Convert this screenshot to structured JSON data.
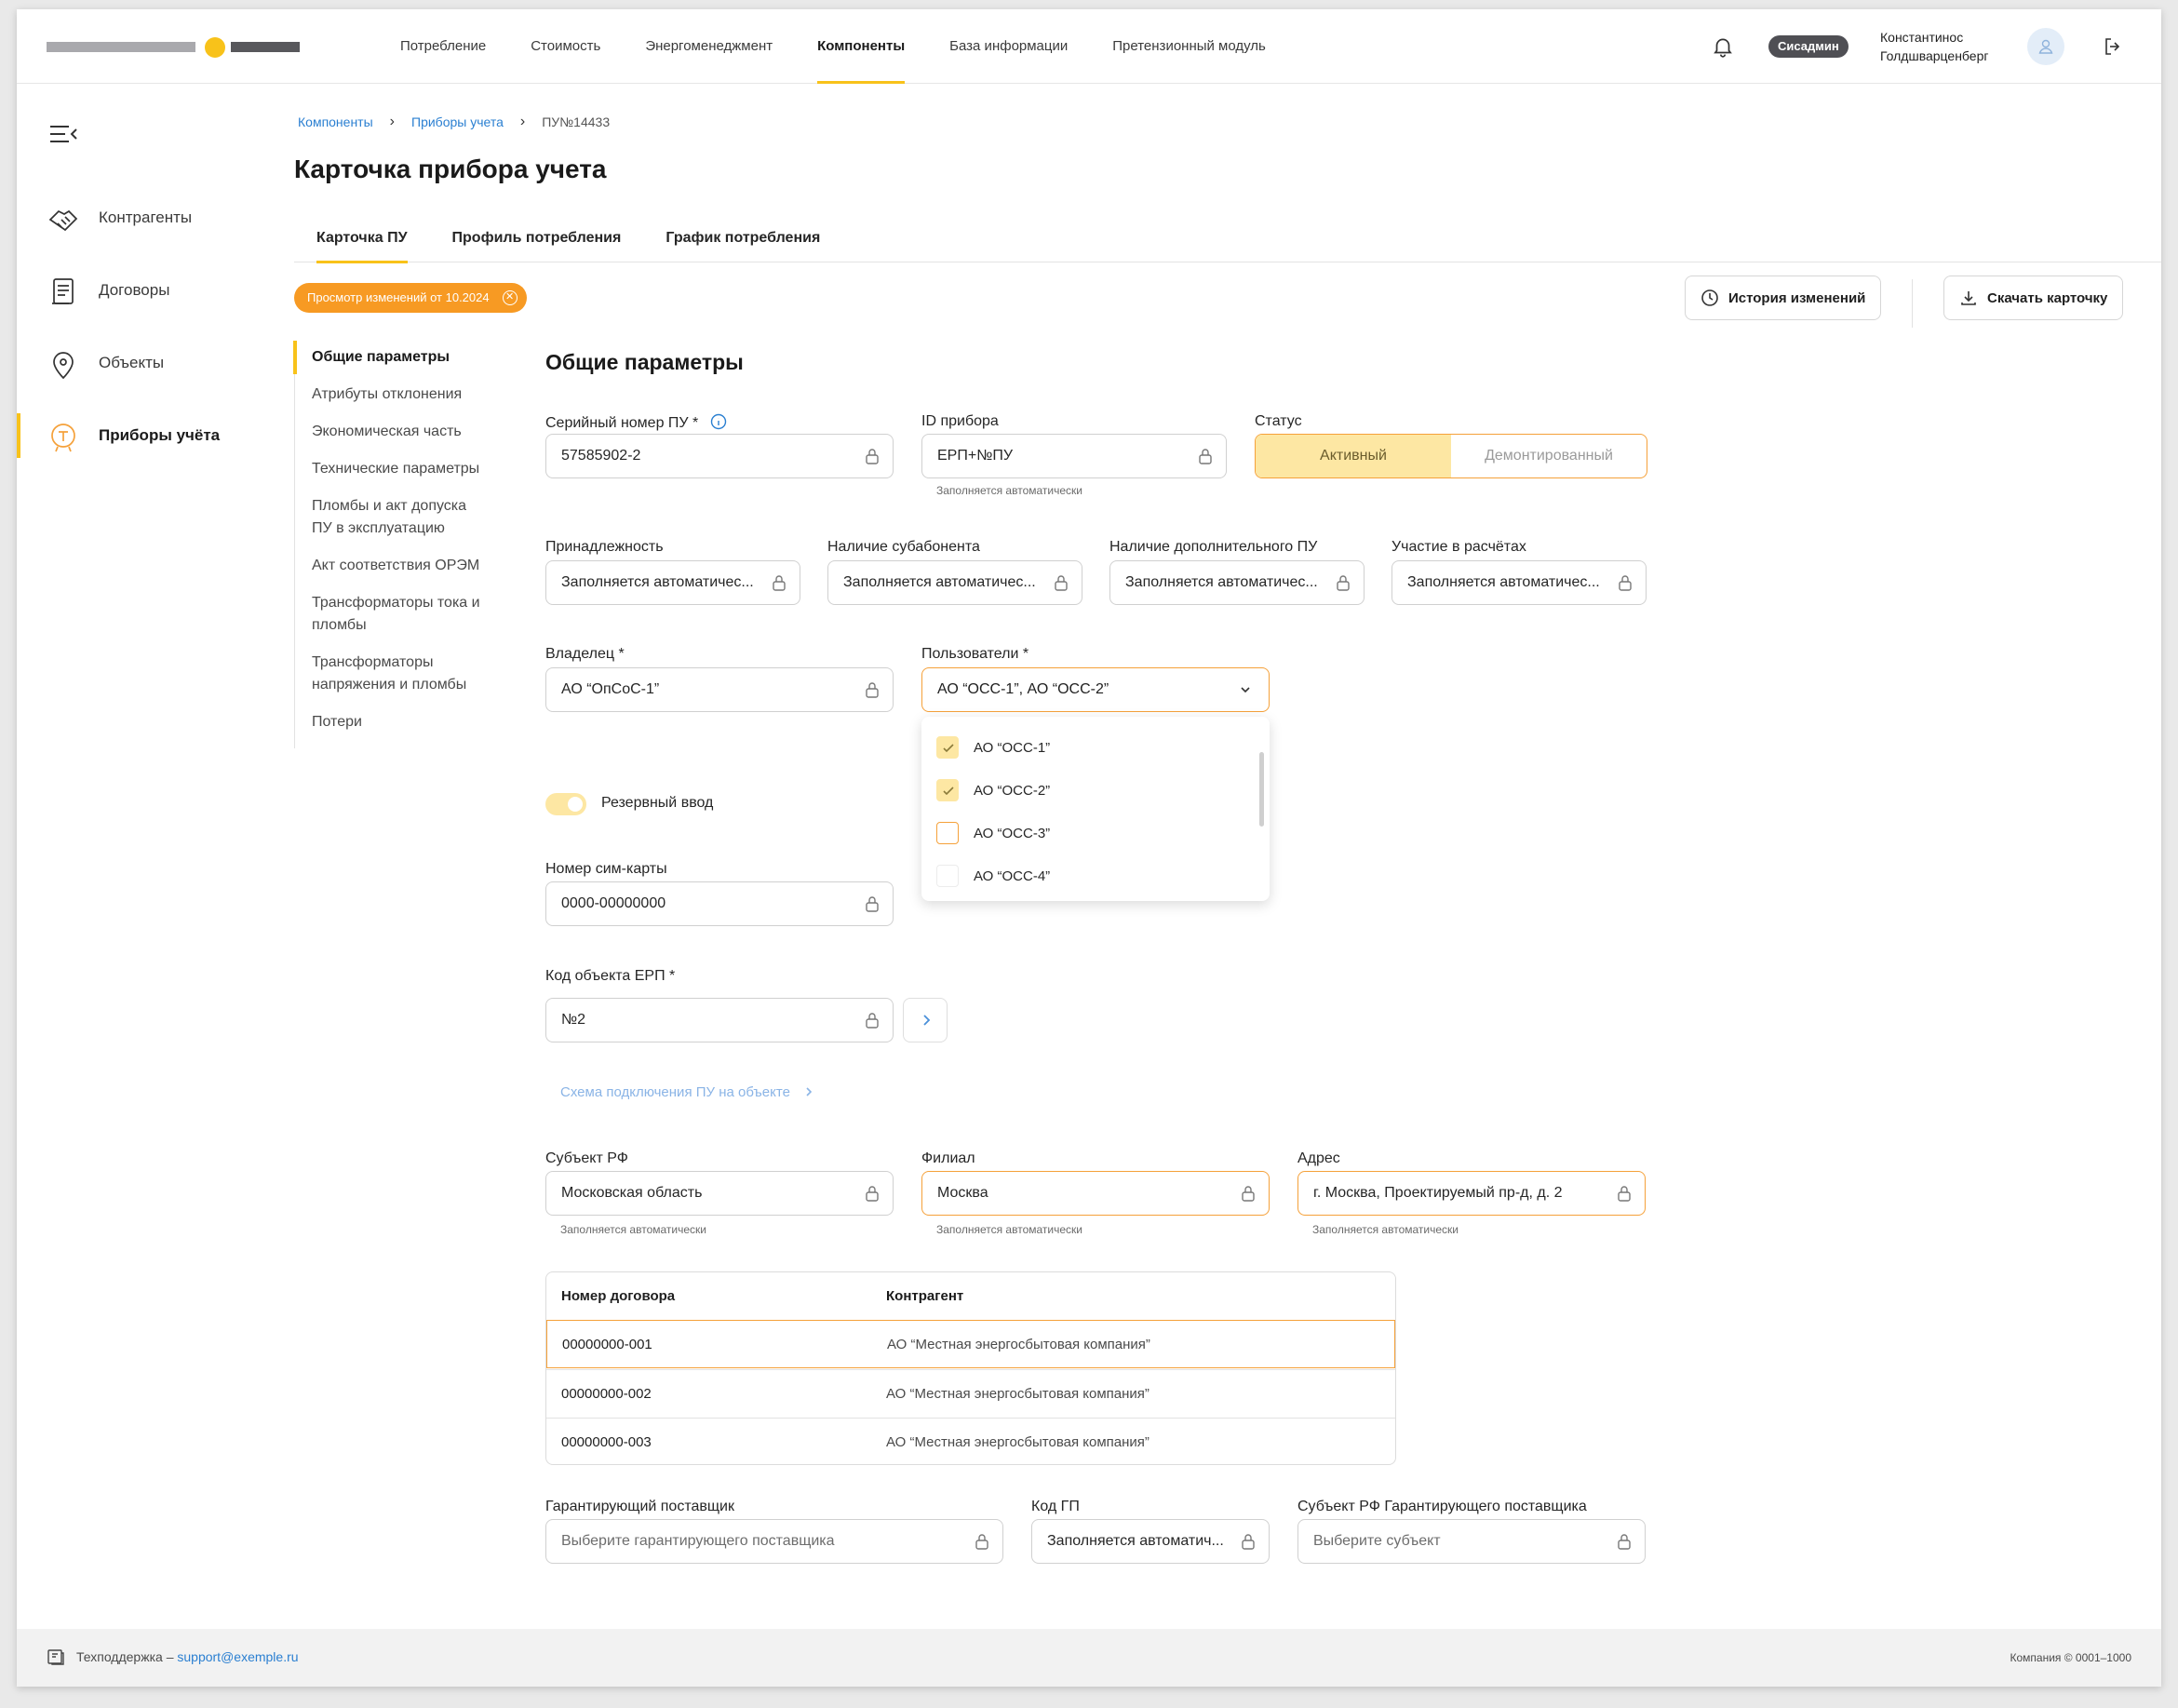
{
  "topnav": {
    "items": [
      "Потребление",
      "Стоимость",
      "Энергоменеджмент",
      "Компоненты",
      "База информации",
      "Претензионный модуль"
    ],
    "active_index": 3
  },
  "user": {
    "role": "Сисадмин",
    "name_line1": "Константинос",
    "name_line2": "Голдшварценберг"
  },
  "sidebar": {
    "items": [
      {
        "label": "Контрагенты",
        "icon": "handshake-icon"
      },
      {
        "label": "Договоры",
        "icon": "document-icon"
      },
      {
        "label": "Объекты",
        "icon": "location-pin-icon"
      },
      {
        "label": "Приборы учёта",
        "icon": "meter-icon"
      }
    ],
    "active_index": 3
  },
  "breadcrumb": [
    "Компоненты",
    "Приборы учета",
    "ПУ№14433"
  ],
  "page_title": "Карточка прибора учета",
  "tabs": [
    "Карточка ПУ",
    "Профиль потребления",
    "График потребления"
  ],
  "view_badge": "Просмотр изменений от 10.2024",
  "buttons": {
    "history": "История изменений",
    "download": "Скачать карточку"
  },
  "secnav": [
    "Общие параметры",
    "Атрибуты отклонения",
    "Экономическая часть",
    "Технические параметры",
    "Пломбы и акт допуска ПУ в эксплуатацию",
    "Акт соответствия ОРЭМ",
    "Трансформаторы тока и пломбы",
    "Трансформаторы напряжения и пломбы",
    "Потери"
  ],
  "section_title": "Общие параметры",
  "auto_hint": "Заполняется автоматически",
  "fields": {
    "serial": {
      "label": "Серийный номер ПУ *",
      "value": "57585902-2"
    },
    "device_id": {
      "label": "ID прибора",
      "value": "ЕРП+№ПУ"
    },
    "status": {
      "label": "Статус",
      "options": [
        "Активный",
        "Демонтированный"
      ],
      "selected": "Активный"
    },
    "belonging": {
      "label": "Принадлежность",
      "value": "Заполняется автоматичес..."
    },
    "subscriber": {
      "label": "Наличие субабонента",
      "value": "Заполняется автоматичес..."
    },
    "extra_pu": {
      "label": "Наличие дополнительного ПУ",
      "value": "Заполняется автоматичес..."
    },
    "calc": {
      "label": "Участие в расчётах",
      "value": "Заполняется автоматичес..."
    },
    "owner": {
      "label": "Владелец *",
      "value": "АО “ОпСоС-1”"
    },
    "users": {
      "label": "Пользователи *",
      "value": "АО “ОСС-1”, АО “ОСС-2”",
      "options": [
        {
          "label": "АО “ОСС-1”",
          "checked": true
        },
        {
          "label": "АО “ОСС-2”",
          "checked": true
        },
        {
          "label": "АО “ОСС-3”",
          "checked": false
        },
        {
          "label": "АО “ОСС-4”",
          "checked": false
        }
      ]
    },
    "reserve": {
      "label": "Резервный ввод",
      "on": true
    },
    "sim": {
      "label": "Номер сим-карты",
      "value": "0000-00000000"
    },
    "erp_code": {
      "label": "Код объекта ЕРП *",
      "value": "№2"
    },
    "scheme_link": "Схема подключения ПУ на объекте",
    "region": {
      "label": "Субъект РФ",
      "value": "Московская область"
    },
    "branch": {
      "label": "Филиал",
      "value": "Москва"
    },
    "address": {
      "label": "Адрес",
      "value": "г. Москва, Проектируемый пр-д, д. 2"
    },
    "supplier": {
      "label": "Гарантирующий поставщик",
      "placeholder": "Выберите гарантирующего поставщика"
    },
    "gp_code": {
      "label": "Код ГП",
      "value": "Заполняется автоматич..."
    },
    "supplier_region": {
      "label": "Субъект РФ Гарантирующего поставщика",
      "placeholder": "Выберите субъект"
    }
  },
  "contracts_table": {
    "headers": [
      "Номер договора",
      "Контрагент"
    ],
    "rows": [
      [
        "00000000-001",
        "АО “Местная энергосбытовая компания”"
      ],
      [
        "00000000-002",
        "АО “Местная энергосбытовая компания”"
      ],
      [
        "00000000-003",
        "АО “Местная энергосбытовая компания”"
      ]
    ],
    "selected_row": 0
  },
  "footer": {
    "support_label": "Техподдержка –",
    "support_email": "support@exemple.ru",
    "company": "Компания © 0001–1000"
  },
  "colors": {
    "accent": "#f8c21a",
    "warning": "#f5a13a",
    "badge": "#f79a23",
    "link": "#2a7fd1"
  }
}
